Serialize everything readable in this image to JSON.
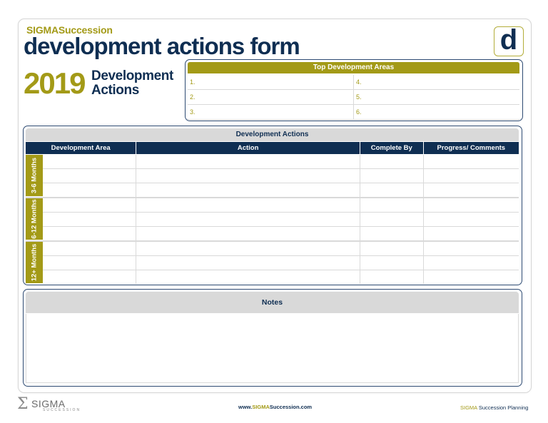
{
  "brand": {
    "sigma": "SIGMA",
    "succession": "Succession"
  },
  "title": "development actions form",
  "logo_letter": "d",
  "year": "2019",
  "year_sub_line1": "Development",
  "year_sub_line2": "Actions",
  "top_areas": {
    "heading": "Top Development Areas",
    "items": [
      "1.",
      "4.",
      "2.",
      "5.",
      "3.",
      "6."
    ]
  },
  "dev_actions": {
    "heading": "Development Actions",
    "columns": [
      "Development Area",
      "Action",
      "Complete By",
      "Progress/ Comments"
    ],
    "periods": [
      "3-6 Months",
      "6-12 Months",
      "12+ Months"
    ]
  },
  "notes": {
    "heading": "Notes"
  },
  "footer": {
    "logo_word": "SIGMA",
    "logo_sub": "SUCCESSION",
    "url_pre": "www.",
    "url_hl": "SIGMA",
    "url_post": "Succession.com",
    "right_hl": "SIGMA",
    "right_post": " Succession Planning"
  },
  "colors": {
    "navy": "#0f2e52",
    "olive": "#a39a17",
    "grey": "#d9d9d9"
  }
}
